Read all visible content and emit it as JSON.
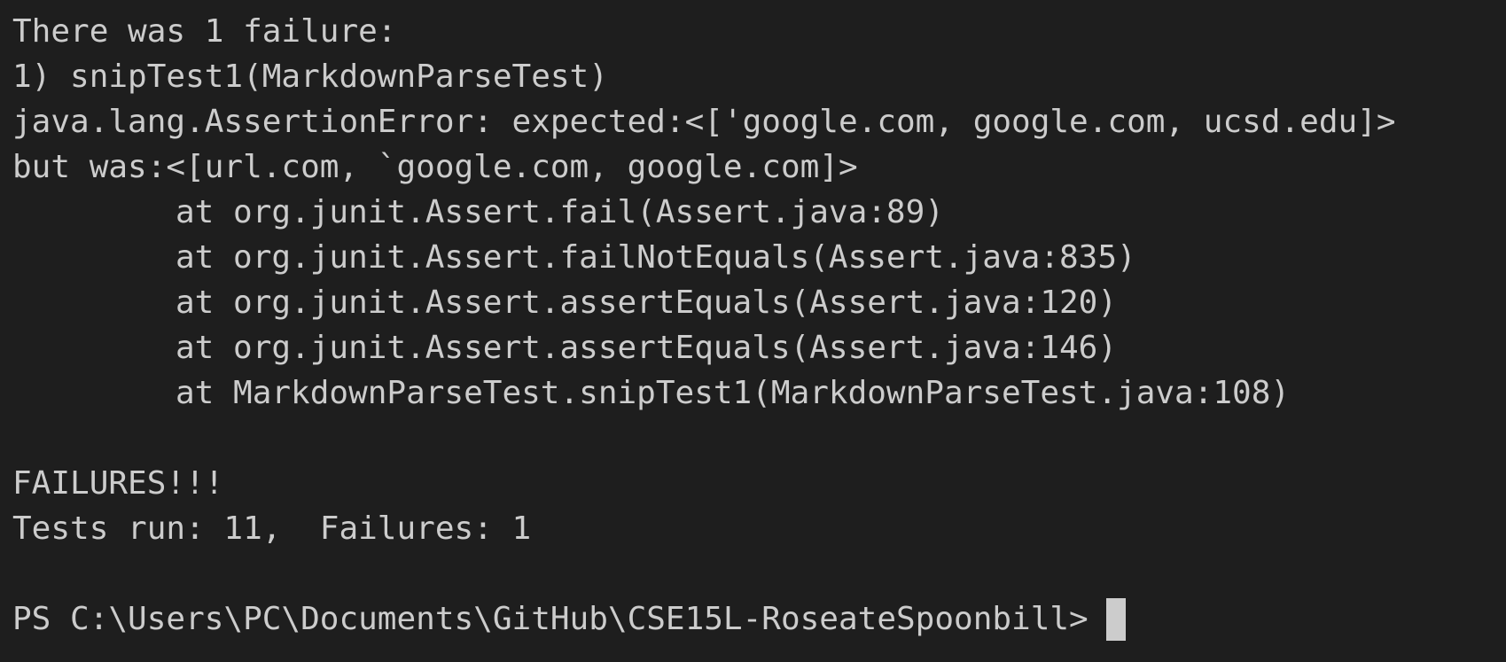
{
  "terminal": {
    "header": {
      "summary": "There was 1 failure:",
      "failure_title": "1) snipTest1(MarkdownParseTest)",
      "error_line": "java.lang.AssertionError: expected:<['google.com, google.com, ucsd.edu]>",
      "actual_line": "but was:<[url.com, `google.com, google.com]>"
    },
    "stack_trace": [
      "at org.junit.Assert.fail(Assert.java:89)",
      "at org.junit.Assert.failNotEquals(Assert.java:835)",
      "at org.junit.Assert.assertEquals(Assert.java:120)",
      "at org.junit.Assert.assertEquals(Assert.java:146)",
      "at MarkdownParseTest.snipTest1(MarkdownParseTest.java:108)"
    ],
    "result": {
      "failures_banner": "FAILURES!!!",
      "summary": "Tests run: 11,  Failures: 1"
    },
    "prompt": {
      "text": "PS C:\\Users\\PC\\Documents\\GitHub\\CSE15L-RoseateSpoonbill>"
    },
    "colors": {
      "background": "#1e1e1e",
      "foreground": "#cccccc"
    }
  }
}
